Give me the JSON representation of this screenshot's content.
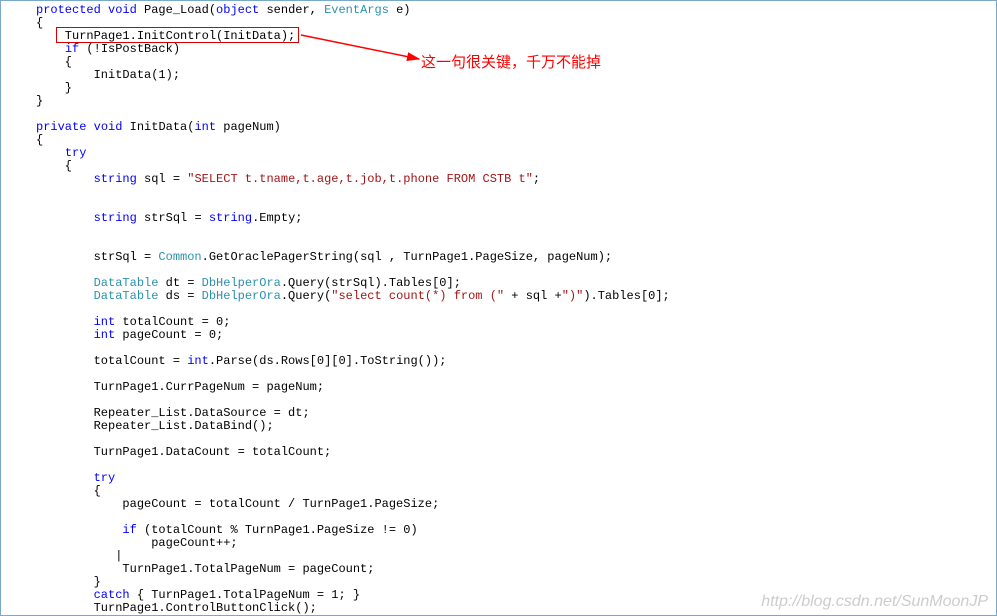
{
  "annotation": "这一句很关键，千万不能掉",
  "watermark": "http://blog.csdn.net/SunMoonJP",
  "code": {
    "l1_a": "protected",
    "l1_b": "void",
    "l1_c": " Page_Load(",
    "l1_d": "object",
    "l1_e": " sender, ",
    "l1_f": "EventArgs",
    "l1_g": " e)",
    "l2": "{",
    "l3": "    TurnPage1.InitControl(InitData);",
    "l4_a": "    ",
    "l4_b": "if",
    "l4_c": " (!IsPostBack)",
    "l5": "    {",
    "l6": "        InitData(1);",
    "l7": "    }",
    "l8": "}",
    "l9": "",
    "l10_a": "private",
    "l10_b": "void",
    "l10_c": " InitData(",
    "l10_d": "int",
    "l10_e": " pageNum)",
    "l11": "{",
    "l12_a": "    ",
    "l12_b": "try",
    "l13": "    {",
    "l14_a": "        ",
    "l14_b": "string",
    "l14_c": " sql = ",
    "l14_d": "\"SELECT t.tname,t.age,t.job,t.phone FROM CSTB t\"",
    "l14_e": ";",
    "l15": "",
    "l16": "",
    "l17_a": "        ",
    "l17_b": "string",
    "l17_c": " strSql = ",
    "l17_d": "string",
    "l17_e": ".Empty;",
    "l18": "",
    "l19": "",
    "l20_a": "        strSql = ",
    "l20_b": "Common",
    "l20_c": ".GetOraclePagerString(sql , TurnPage1.PageSize, pageNum);",
    "l21": "",
    "l22_a": "        ",
    "l22_b": "DataTable",
    "l22_c": " dt = ",
    "l22_d": "DbHelperOra",
    "l22_e": ".Query(strSql).Tables[0];",
    "l23_a": "        ",
    "l23_b": "DataTable",
    "l23_c": " ds = ",
    "l23_d": "DbHelperOra",
    "l23_e": ".Query(",
    "l23_f": "\"select count(*) from (\"",
    "l23_g": " + sql +",
    "l23_h": "\")\"",
    "l23_i": ").Tables[0];",
    "l24": "",
    "l25_a": "        ",
    "l25_b": "int",
    "l25_c": " totalCount = 0;",
    "l26_a": "        ",
    "l26_b": "int",
    "l26_c": " pageCount = 0;",
    "l27": "",
    "l28_a": "        totalCount = ",
    "l28_b": "int",
    "l28_c": ".Parse(ds.Rows[0][0].ToString());",
    "l29": "",
    "l30": "        TurnPage1.CurrPageNum = pageNum;",
    "l31": "",
    "l32": "        Repeater_List.DataSource = dt;",
    "l33": "        Repeater_List.DataBind();",
    "l34": "",
    "l35": "        TurnPage1.DataCount = totalCount;",
    "l36": "",
    "l37_a": "        ",
    "l37_b": "try",
    "l38": "        {",
    "l39": "            pageCount = totalCount / TurnPage1.PageSize;",
    "l40": "",
    "l41_a": "            ",
    "l41_b": "if",
    "l41_c": " (totalCount % TurnPage1.PageSize != 0)",
    "l42": "                pageCount++;",
    "l43": "           |",
    "l44": "            TurnPage1.TotalPageNum = pageCount;",
    "l45": "        }",
    "l46_a": "        ",
    "l46_b": "catch",
    "l46_c": " { TurnPage1.TotalPageNum = 1; }",
    "l47": "        TurnPage1.ControlButtonClick();"
  }
}
